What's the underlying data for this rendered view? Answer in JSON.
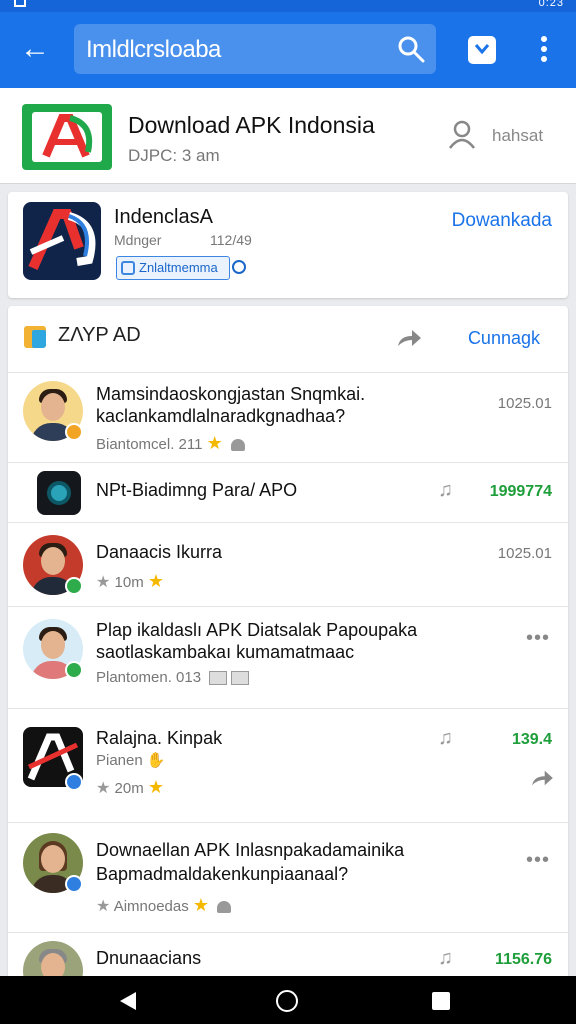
{
  "status_bar": {
    "time": "0:23"
  },
  "app_bar": {
    "search_text": "Imldlcrsloaba"
  },
  "header": {
    "title": "Download APK Indonsia",
    "subtitle": "DJPC: 3 am",
    "user_label": "hahsat"
  },
  "app_card": {
    "name": "IndenclasA",
    "meta_left": "Mdnger",
    "meta_right": "112/49",
    "badge": "Znlaltmemma",
    "action": "Dowankada"
  },
  "feed": {
    "section_title": "ΖΛΥΡ ΑD",
    "section_action": "Cunnagk",
    "items": [
      {
        "line1": "Mamsindaoskongjastan Snqmkai.",
        "line2": "kaclankamdlalnaradkgnadhaa?",
        "meta": "Biantomcel. 211",
        "value": "1025.01"
      },
      {
        "line1": "NPt-Biadimng Para/ APO",
        "value": "1999774"
      },
      {
        "line1": "Danaacis Ikurra",
        "meta": "10m",
        "value": "1025.01"
      },
      {
        "line1": "Plap ikaldaslı APK Diatsalak Papoupaka",
        "line2": "saotlaskambakaı kumamatmaac",
        "meta": "Plantomen. 013"
      },
      {
        "line1": "Ralajna. Kinpak",
        "line2": "Pianen",
        "meta": "20m",
        "value": "139.4"
      },
      {
        "line1": "Downaellan APK Inlasnpakadamainika",
        "line2": "Bapmadmaldakenkunpiaanaal?",
        "meta": "Aimnoedas"
      },
      {
        "line1": "Dnunaacians",
        "value": "1156.76"
      }
    ]
  },
  "colors": {
    "primary": "#1a73e8",
    "positive": "#1e9e3a",
    "star": "#f5b800"
  }
}
